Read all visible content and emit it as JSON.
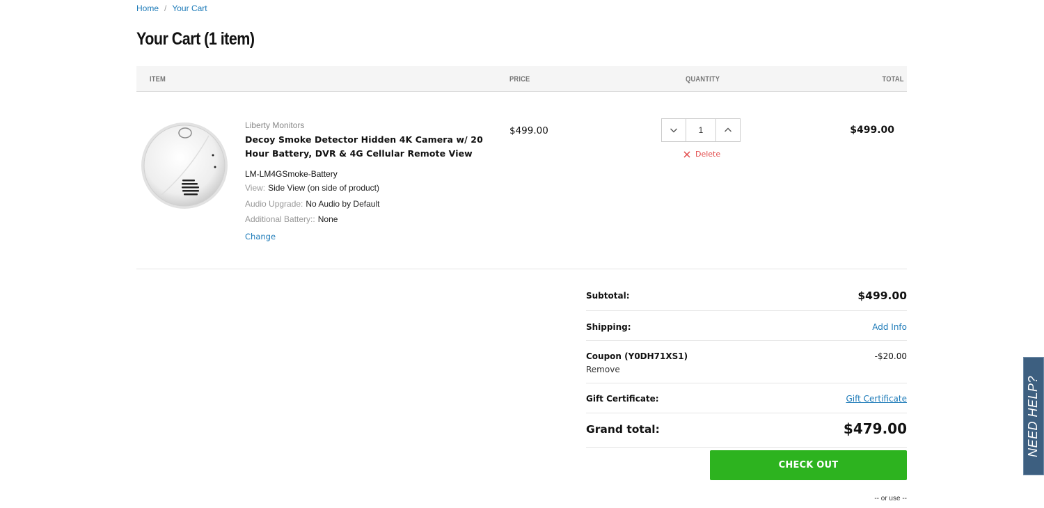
{
  "breadcrumb": {
    "home": "Home",
    "separator": "/",
    "current": "Your Cart"
  },
  "page_title": "Your Cart (1 item)",
  "table_headers": {
    "item": "ITEM",
    "price": "PRICE",
    "quantity": "QUANTITY",
    "total": "TOTAL"
  },
  "cart_item": {
    "image_icon": "smoke-detector-image",
    "brand": "Liberty Monitors",
    "name": "Decoy Smoke Detector Hidden 4K Camera w/ 20 Hour Battery, DVR & 4G Cellular Remote View",
    "sku": "LM-LM4GSmoke-Battery",
    "options": [
      {
        "label": "View:",
        "value": "Side View (on side of product)"
      },
      {
        "label": "Audio Upgrade:",
        "value": "No Audio by Default"
      },
      {
        "label": "Additional Battery::",
        "value": "None"
      }
    ],
    "change_label": "Change",
    "price": "$499.00",
    "quantity": "1",
    "delete_label": "Delete",
    "total": "$499.00"
  },
  "totals": {
    "subtotal_label": "Subtotal:",
    "subtotal_value": "$499.00",
    "shipping_label": "Shipping:",
    "shipping_value": "Add Info",
    "coupon_label": "Coupon (Y0DH71XS1)",
    "coupon_value": "-$20.00",
    "coupon_remove": "Remove",
    "gift_label": "Gift Certificate:",
    "gift_value": "Gift Certificate",
    "grand_label": "Grand total:",
    "grand_value": "$479.00"
  },
  "checkout_label": "CHECK OUT",
  "or_use": "-- or use --",
  "need_help": "NEED HELP?",
  "colors": {
    "link": "#1c7ab8",
    "checkout": "#2db31f",
    "delete": "#e24a4a",
    "help_tab": "#3d5f80"
  }
}
